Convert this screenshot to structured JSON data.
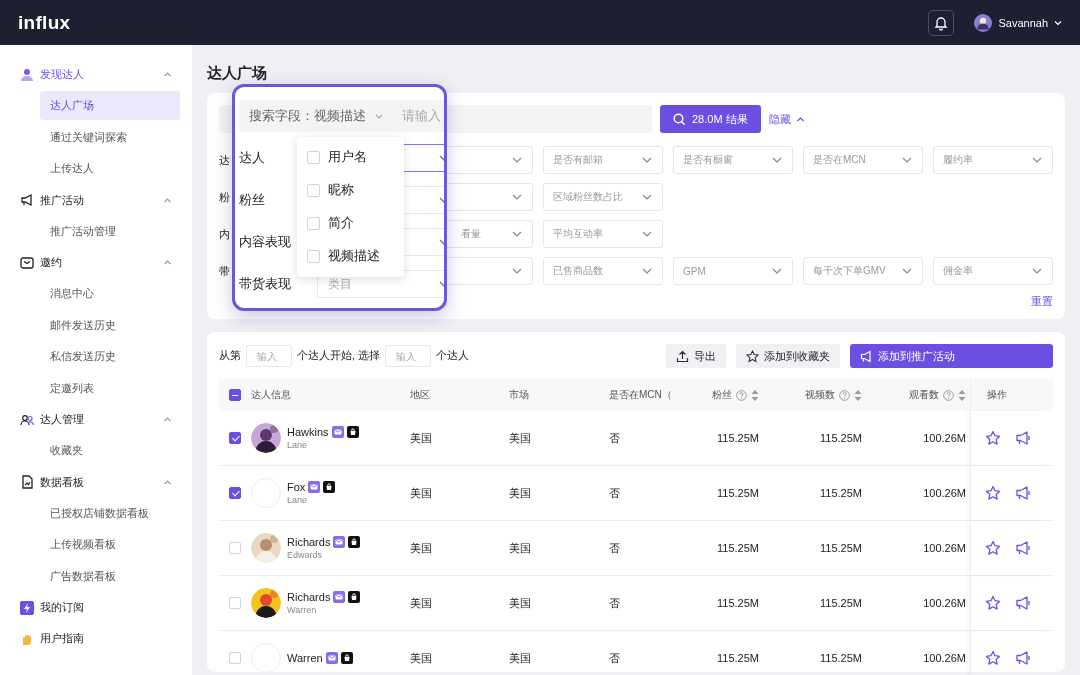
{
  "topbar": {
    "logo": "influx",
    "user": "Savannah"
  },
  "sidebar": [
    {
      "label": "发现达人",
      "expanded": true,
      "children": [
        {
          "label": "达人广场",
          "selected": true
        },
        {
          "label": "通过关键词探索",
          "selected": false
        },
        {
          "label": "上传达人",
          "selected": false
        }
      ]
    },
    {
      "label": "推广活动",
      "expanded": true,
      "children": [
        {
          "label": "推广活动管理",
          "selected": false
        }
      ]
    },
    {
      "label": "邀约",
      "expanded": true,
      "children": [
        {
          "label": "消息中心",
          "selected": false
        },
        {
          "label": "邮件发送历史",
          "selected": false
        },
        {
          "label": "私信发送历史",
          "selected": false
        },
        {
          "label": "定邀列表",
          "selected": false
        }
      ]
    },
    {
      "label": "达人管理",
      "expanded": true,
      "children": [
        {
          "label": "收藏夹",
          "selected": false
        }
      ]
    },
    {
      "label": "数据看板",
      "expanded": true,
      "children": [
        {
          "label": "已授权店铺数据看板",
          "selected": false
        },
        {
          "label": "上传视频看板",
          "selected": false
        },
        {
          "label": "广告数据看板",
          "selected": false
        }
      ]
    },
    {
      "label": "我的订阅"
    },
    {
      "label": "用户指南"
    }
  ],
  "page_title": "达人广场",
  "filters": {
    "button": "28.0M 结果",
    "toggle": "隐藏",
    "reset": "重置",
    "rows": [
      {
        "label": "达",
        "options": [
          "是否有邮箱",
          "是否有橱窗",
          "是否在MCN",
          "履约率"
        ]
      },
      {
        "label": "粉",
        "options": [
          "区域粉丝数占比"
        ]
      },
      {
        "label": "内",
        "partial": "看量",
        "options": [
          "平均互动率"
        ]
      },
      {
        "label": "带",
        "options": [
          "已售商品数",
          "GPM",
          "每千次下单GMV",
          "佣金率"
        ]
      }
    ]
  },
  "callout": {
    "field": "搜索字段：视频描述",
    "placeholder": "请输入",
    "rows": [
      {
        "label": "达人",
        "focused": true
      },
      {
        "label": "粉丝",
        "focused": false
      },
      {
        "label": "内容表现",
        "focused": false
      },
      {
        "label": "带货表现",
        "focused": false,
        "placeholder": "类目"
      }
    ],
    "menu": [
      {
        "label": "用户名",
        "checked": false
      },
      {
        "label": "昵称",
        "checked": false
      },
      {
        "label": "简介",
        "checked": false
      },
      {
        "label": "视频描述",
        "checked": false
      }
    ]
  },
  "table": {
    "range": [
      "从第",
      "个达人开始, 选择",
      "个达人"
    ],
    "range_placeholders": [
      "输入",
      "输入"
    ],
    "actions": [
      {
        "label": "导出",
        "kind": "export"
      },
      {
        "label": "添加到收藏夹",
        "kind": "favorite"
      },
      {
        "label": "添加到推广活动",
        "kind": "campaign"
      }
    ],
    "select_all_partial": true,
    "columns": [
      {
        "label": "达人信息"
      },
      {
        "label": "地区"
      },
      {
        "label": "市场"
      },
      {
        "label": "是否在MCN（"
      },
      {
        "label": "粉丝",
        "help": true,
        "sortable": true
      },
      {
        "label": "视频数",
        "help": true,
        "sortable": true
      },
      {
        "label": "观看数",
        "help": true,
        "sortable": true
      },
      {
        "label": "操作"
      }
    ],
    "rows": [
      {
        "selected": true,
        "photo": true,
        "name": "Hawkins",
        "handle": "Lane",
        "region": "美国",
        "market": "美国",
        "mcn": "否",
        "fans": "115.25M",
        "videos": "115.25M",
        "views": "100.26M"
      },
      {
        "selected": true,
        "photo": false,
        "name": "Fox",
        "handle": "Lane",
        "region": "美国",
        "market": "美国",
        "mcn": "否",
        "fans": "115.25M",
        "videos": "115.25M",
        "views": "100.26M"
      },
      {
        "selected": false,
        "photo": true,
        "name": "Richards",
        "handle": "Edwards",
        "region": "美国",
        "market": "美国",
        "mcn": "否",
        "fans": "115.25M",
        "videos": "115.25M",
        "views": "100.26M"
      },
      {
        "selected": false,
        "photo": true,
        "name": "Richards",
        "handle": "Warren",
        "region": "美国",
        "market": "美国",
        "mcn": "否",
        "fans": "115.25M",
        "videos": "115.25M",
        "views": "100.26M"
      },
      {
        "selected": false,
        "photo": false,
        "name": "Warren",
        "region": "美国",
        "market": "美国",
        "mcn": "否",
        "fans": "115.25M",
        "videos": "115.25M",
        "views": "100.26M"
      }
    ]
  }
}
